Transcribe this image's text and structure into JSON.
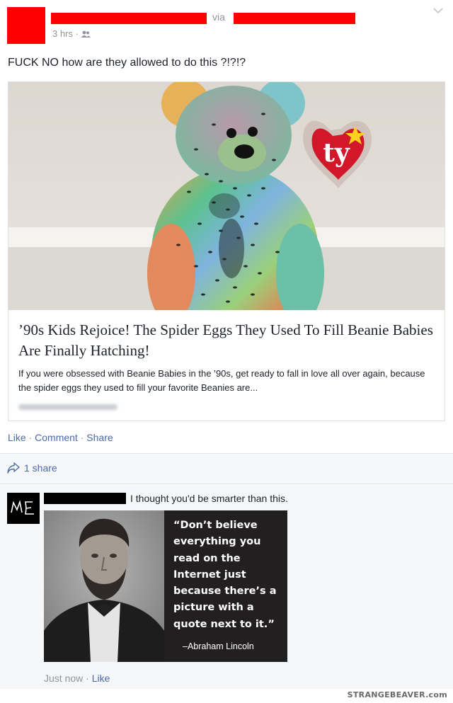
{
  "post": {
    "via_label": "via",
    "time": "3 hrs · ",
    "audience_icon": "friends-icon",
    "text": "FUCK NO how are they allowed to do this ?!?!?",
    "colors": {
      "redaction": "#ff0000",
      "link_blue": "#4b6aa8",
      "meta_gray": "#90949c"
    }
  },
  "link": {
    "photo_tag": "ty",
    "title": "’90s Kids Rejoice! The Spider Eggs They Used To Fill Beanie Babies Are Finally Hatching!",
    "description": "If you were obsessed with Beanie Babies in the ’90s, get ready to fall in love all over again, because the spider eggs they used to fill your favorite Beanies are..."
  },
  "actions": {
    "like": "Like",
    "comment": "Comment",
    "share": "Share",
    "sep": "·"
  },
  "shares": {
    "icon": "share-arrow-icon",
    "label": "1 share"
  },
  "comment": {
    "avatar_text": "ME",
    "text": "I thought you'd be smarter than this.",
    "quote": "“Don’t believe everything you read on the Internet just because there’s a picture with a quote next to it.”",
    "attribution": "–Abraham Lincoln",
    "time": "Just now",
    "sep": "·",
    "like": "Like"
  },
  "watermark": "STRANGEBEAVER.com"
}
